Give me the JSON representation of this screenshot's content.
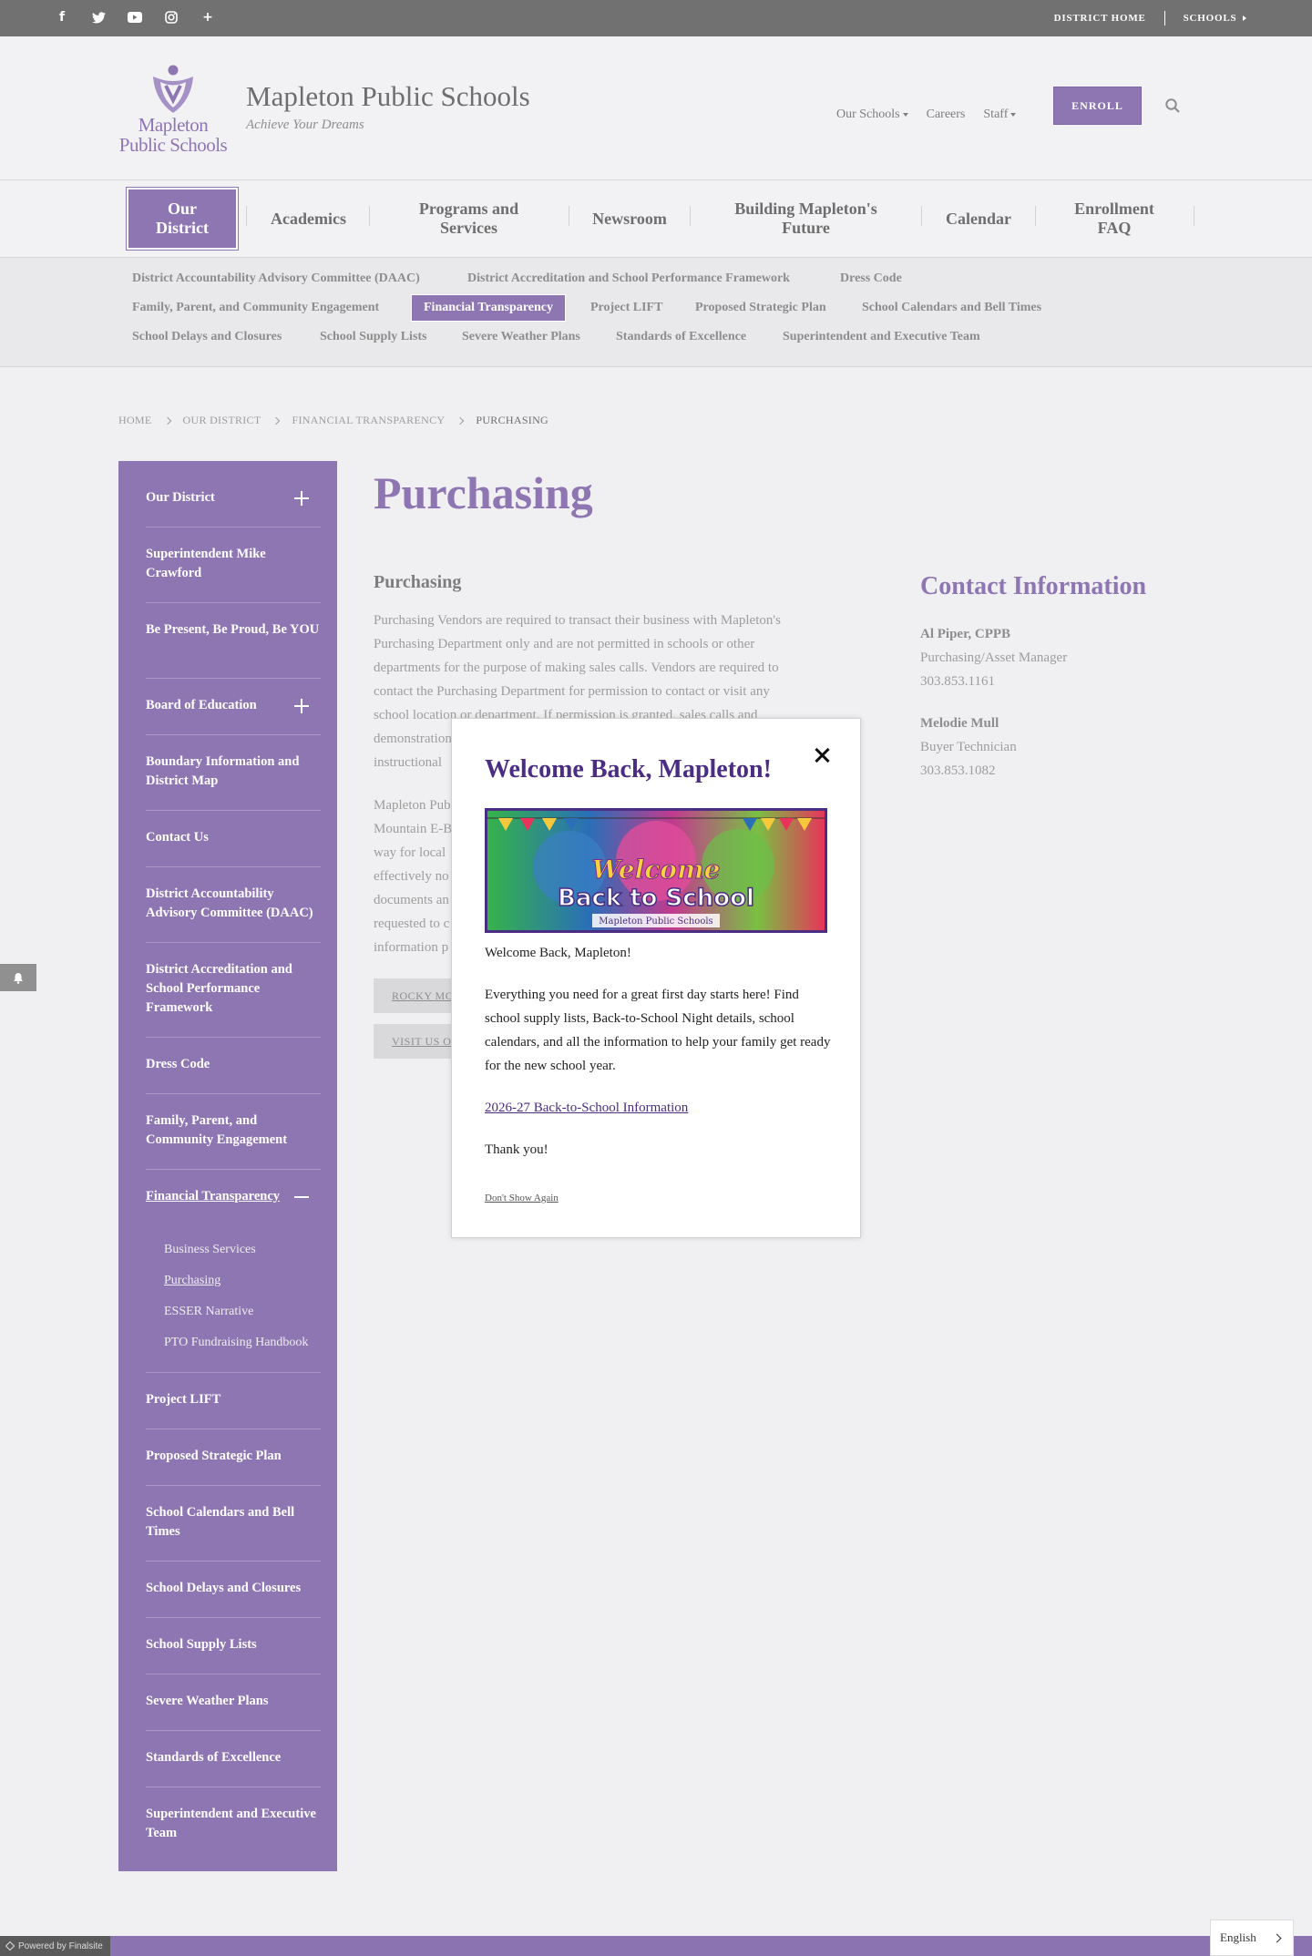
{
  "utility": {
    "social": [
      {
        "icon": "facebook-icon",
        "glyph": "f"
      },
      {
        "icon": "twitter-icon",
        "glyph": "t"
      },
      {
        "icon": "youtube-icon",
        "glyph": "▶"
      },
      {
        "icon": "instagram-icon",
        "glyph": "◎"
      },
      {
        "icon": "plus-icon",
        "glyph": "+"
      }
    ],
    "district_home": "DISTRICT HOME",
    "schools": "SCHOOLS"
  },
  "header": {
    "logo_line1": "Mapleton",
    "logo_line2": "Public Schools",
    "site_name": "Mapleton Public Schools",
    "tagline": "Achieve Your Dreams",
    "nav": {
      "our_schools": "Our Schools",
      "careers": "Careers",
      "staff": "Staff"
    },
    "enroll": "ENROLL"
  },
  "main_nav": [
    "Our\nDistrict",
    "Academics",
    "Programs and\nServices",
    "Newsroom",
    "Building Mapleton's\nFuture",
    "Calendar",
    "Enrollment\nFAQ"
  ],
  "sub_nav": [
    "District Accountability Advisory Committee (DAAC)",
    "District Accreditation and School Performance Framework",
    "Dress Code",
    "Family, Parent, and Community Engagement",
    "Financial Transparency",
    "Project LIFT",
    "Proposed Strategic Plan",
    "School Calendars and Bell Times",
    "School Delays and Closures",
    "School Supply Lists",
    "Severe Weather Plans",
    "Standards of Excellence",
    "Superintendent and Executive Team"
  ],
  "breadcrumb": [
    "HOME",
    "OUR DISTRICT",
    "FINANCIAL TRANSPARENCY",
    "PURCHASING"
  ],
  "side_menu": [
    "Our District",
    "Superintendent Mike Crawford",
    "Be Present, Be Proud, Be YOU",
    "Board of Education",
    "Boundary Information and District Map",
    "Contact Us",
    "District Accountability Advisory Committee (DAAC)",
    "District Accreditation and School Performance Framework",
    "Dress Code",
    "Family, Parent, and Community Engagement",
    "Financial Transparency",
    "Project LIFT",
    "Proposed Strategic Plan",
    "School Calendars and Bell Times",
    "School Delays and Closures",
    "School Supply Lists",
    "Severe Weather Plans",
    "Standards of Excellence",
    "Superintendent and Executive Team"
  ],
  "side_sub": [
    "Business Services",
    "Purchasing",
    "ESSER Narrative",
    "PTO Fundraising Handbook"
  ],
  "content": {
    "title": "Purchasing",
    "section_title": "Purchasing",
    "para1_lines": [
      "Purchasing Vendors are required to transact their business with Mapleton's",
      "Purchasing Department only and are not permitted in schools or other",
      "departments for the purpose of making sales calls. Vendors are required to",
      "contact the Purchasing Department for permission to contact or visit any",
      "school location or department. If permission is granted, sales calls and",
      "demonstration",
      "instructional"
    ],
    "para2_lines": [
      "Mapleton Pub",
      "Mountain E-B",
      "way for local",
      "effectively no",
      "documents an",
      "requested to c",
      "information p"
    ],
    "btn1": "ROCKY MO",
    "btn2": "VISIT US O"
  },
  "contact": {
    "title": "Contact Information",
    "p1_name": "Al Piper, CPPB",
    "p1_role": "Purchasing/Asset Manager",
    "p1_phone": "303.853.1161",
    "p2_name": "Melodie Mull",
    "p2_role": "Buyer Technician",
    "p2_phone": "303.853.1082"
  },
  "modal": {
    "title": "Welcome Back, Mapleton!",
    "banner_welcome": "Welcome",
    "banner_bts": "Back to School",
    "banner_org": "Mapleton Public Schools",
    "greeting": "Welcome Back, Mapleton!",
    "body": "Everything you need for a great first day starts here! Find school supply lists, Back-to-School Night details, school calendars, and all the information to help your family get ready for the new school year.",
    "link": "2026-27 Back-to-School Information",
    "thanks": "Thank you!",
    "dont_show": "Don't Show Again"
  },
  "footer": {
    "powered": "Powered by Finalsite",
    "language": "English"
  },
  "colors": {
    "brand_purple": "#8b72b0",
    "modal_purple": "#4b2d83",
    "utility_gray": "#6d6d6d"
  }
}
